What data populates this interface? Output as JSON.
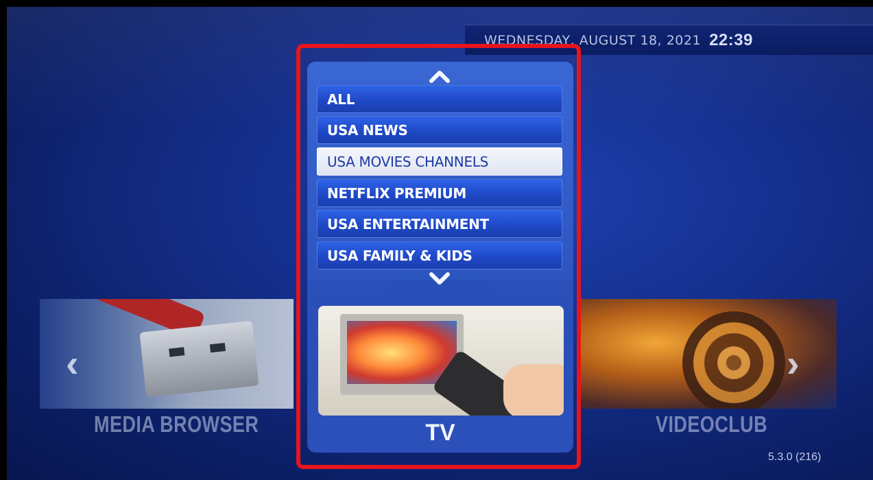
{
  "header": {
    "date": "WEDNESDAY, AUGUST 18, 2021",
    "time": "22:39"
  },
  "menu": {
    "items": [
      {
        "label": "ALL"
      },
      {
        "label": "USA NEWS"
      },
      {
        "label": "USA MOVIES CHANNELS",
        "selected": true
      },
      {
        "label": "NETFLIX PREMIUM"
      },
      {
        "label": "USA ENTERTAINMENT"
      },
      {
        "label": "USA FAMILY & KIDS"
      }
    ],
    "scroll_up_icon": "chevron-up-icon",
    "scroll_down_icon": "chevron-down-icon"
  },
  "tiles": {
    "left_label": "MEDIA BROWSER",
    "center_label": "TV",
    "right_label": "VIDEOCLUB"
  },
  "navigation": {
    "prev_icon": "chevron-left-icon",
    "next_icon": "chevron-right-icon"
  },
  "version": "5.3.0 (216)",
  "colors": {
    "highlight_frame": "#e8141c",
    "background": "#15308f",
    "selected_item": "#f4f6fb"
  }
}
